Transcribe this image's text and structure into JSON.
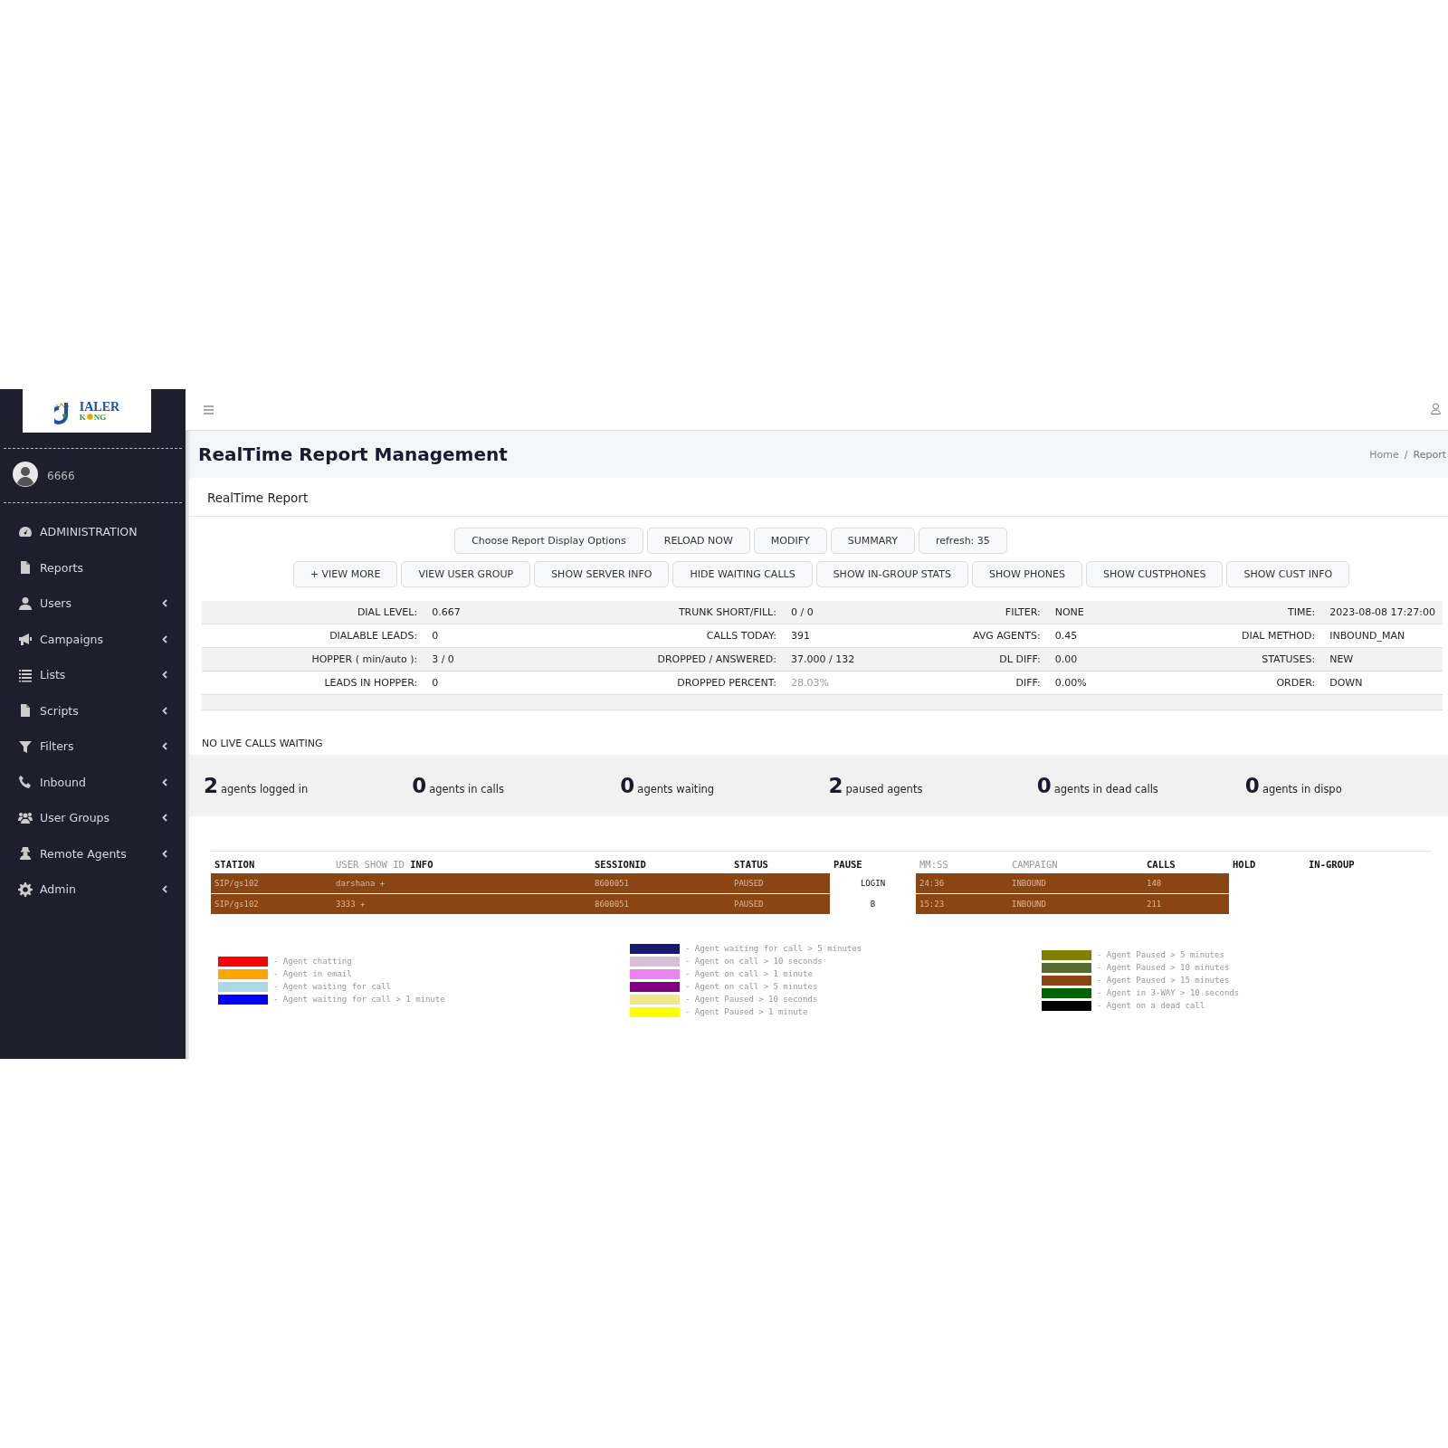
{
  "sidebar": {
    "logo": {
      "top": "IALER",
      "bottom_left": "K",
      "bottom_right": "NG"
    },
    "user": {
      "name": "6666"
    },
    "items": [
      {
        "label": "ADMINISTRATION",
        "expandable": false
      },
      {
        "label": "Reports",
        "expandable": false
      },
      {
        "label": "Users",
        "expandable": true
      },
      {
        "label": "Campaigns",
        "expandable": true
      },
      {
        "label": "Lists",
        "expandable": true
      },
      {
        "label": "Scripts",
        "expandable": true
      },
      {
        "label": "Filters",
        "expandable": true
      },
      {
        "label": "Inbound",
        "expandable": true
      },
      {
        "label": "User Groups",
        "expandable": true
      },
      {
        "label": "Remote Agents",
        "expandable": true
      },
      {
        "label": "Admin",
        "expandable": true
      }
    ]
  },
  "page": {
    "title": "RealTime Report Management",
    "breadcrumb_separator": "/",
    "breadcrumb": [
      {
        "label": "Home",
        "link": true
      },
      {
        "label": "Report",
        "link": false
      }
    ]
  },
  "card": {
    "title": "RealTime Report",
    "buttons_row_1": [
      "Choose Report Display Options",
      "RELOAD NOW",
      "MODIFY",
      "SUMMARY",
      "refresh: 35"
    ],
    "buttons_row_2": [
      "+ VIEW MORE",
      "VIEW USER GROUP",
      "SHOW SERVER INFO",
      "HIDE WAITING CALLS",
      "SHOW IN-GROUP STATS",
      "SHOW PHONES",
      "SHOW CUSTPHONES",
      "SHOW CUST INFO"
    ],
    "stats": [
      [
        {
          "label": "DIAL LEVEL:",
          "value": "0.667",
          "muted": false
        },
        {
          "label": "TRUNK SHORT/FILL:",
          "value": "0 / 0",
          "muted": false
        },
        {
          "label": "FILTER:",
          "value": "NONE",
          "muted": false
        },
        {
          "label": "TIME:",
          "value": "2023-08-08 17:27:00",
          "muted": false
        }
      ],
      [
        {
          "label": "DIALABLE LEADS:",
          "value": "0",
          "muted": false
        },
        {
          "label": "CALLS TODAY:",
          "value": "391",
          "muted": false
        },
        {
          "label": "AVG AGENTS:",
          "value": "0.45",
          "muted": false
        },
        {
          "label": "DIAL METHOD:",
          "value": "INBOUND_MAN",
          "muted": false
        }
      ],
      [
        {
          "label": "HOPPER ( min/auto ):",
          "value": "3 / 0",
          "muted": false
        },
        {
          "label": "DROPPED / ANSWERED:",
          "value": "37.000 / 132",
          "muted": false
        },
        {
          "label": "DL DIFF:",
          "value": "0.00",
          "muted": false
        },
        {
          "label": "STATUSES:",
          "value": "NEW",
          "muted": false
        }
      ],
      [
        {
          "label": "LEADS IN HOPPER:",
          "value": "0",
          "muted": false
        },
        {
          "label": "DROPPED PERCENT:",
          "value": "28.03%",
          "muted": true
        },
        {
          "label": "DIFF:",
          "value": "0.00%",
          "muted": false
        },
        {
          "label": "ORDER:",
          "value": "DOWN",
          "muted": false
        }
      ]
    ],
    "waiting_notice": "NO LIVE CALLS WAITING",
    "summary": [
      {
        "count": "2",
        "label": "agents logged in"
      },
      {
        "count": "0",
        "label": "agents in calls"
      },
      {
        "count": "0",
        "label": "agents waiting"
      },
      {
        "count": "2",
        "label": "paused agents"
      },
      {
        "count": "0",
        "label": "agents in dead calls"
      },
      {
        "count": "0",
        "label": "agents in dispo"
      }
    ],
    "table": {
      "columns": [
        {
          "parts": [
            {
              "text": "STATION",
              "muted": false
            }
          ]
        },
        {
          "parts": [
            {
              "text": "USER SHOW ID",
              "muted": true
            },
            {
              "text": "INFO",
              "muted": false
            }
          ]
        },
        {
          "parts": [
            {
              "text": "SESSIONID",
              "muted": false
            }
          ]
        },
        {
          "parts": [
            {
              "text": "STATUS",
              "muted": false
            }
          ]
        },
        {
          "parts": [
            {
              "text": "PAUSE",
              "muted": false
            }
          ]
        },
        {
          "parts": [
            {
              "text": "MM:SS",
              "muted": true
            }
          ]
        },
        {
          "parts": [
            {
              "text": "CAMPAIGN",
              "muted": true
            }
          ]
        },
        {
          "parts": [
            {
              "text": "CALLS",
              "muted": false
            }
          ]
        },
        {
          "parts": [
            {
              "text": "HOLD",
              "muted": false
            }
          ]
        },
        {
          "parts": [
            {
              "text": "IN-GROUP",
              "muted": false
            }
          ]
        }
      ],
      "rows": [
        {
          "color": "#8b4513",
          "cells": [
            "SIP/gs102",
            "darshana +",
            "8600051",
            "PAUSED",
            "LOGIN",
            "24:36",
            "INBOUND",
            "148"
          ]
        },
        {
          "color": "#8b4513",
          "cells": [
            "SIP/gs102",
            "3333 +",
            "8600051",
            "PAUSED",
            "B",
            "15:23",
            "INBOUND",
            "211"
          ]
        }
      ]
    },
    "legend": [
      [
        {
          "color": "#ff0000",
          "label": "- Agent chatting"
        },
        {
          "color": "#ffa500",
          "label": "- Agent in email"
        },
        {
          "color": "#add8e6",
          "label": "- Agent waiting for call"
        },
        {
          "color": "#0000ff",
          "label": "- Agent waiting for call > 1 minute"
        }
      ],
      [
        {
          "color": "#191970",
          "label": "- Agent waiting for call > 5 minutes"
        },
        {
          "color": "#d8bfd8",
          "label": "- Agent on call > 10 seconds"
        },
        {
          "color": "#ee82ee",
          "label": "- Agent on call > 1 minute"
        },
        {
          "color": "#800080",
          "label": "- Agent on call > 5 minutes"
        },
        {
          "color": "#f0e68c",
          "label": "- Agent Paused > 10 seconds"
        },
        {
          "color": "#ffff00",
          "label": "- Agent Paused > 1 minute"
        }
      ],
      [
        {
          "color": "#808000",
          "label": "- Agent Paused > 5 minutes"
        },
        {
          "color": "#556b2f",
          "label": "- Agent Paused > 10 minutes"
        },
        {
          "color": "#8b4513",
          "label": "- Agent Paused > 15 minutes"
        },
        {
          "color": "#006400",
          "label": "- Agent in 3-WAY > 10 seconds"
        },
        {
          "color": "#000000",
          "label": "- Agent on a dead call"
        }
      ]
    ]
  }
}
